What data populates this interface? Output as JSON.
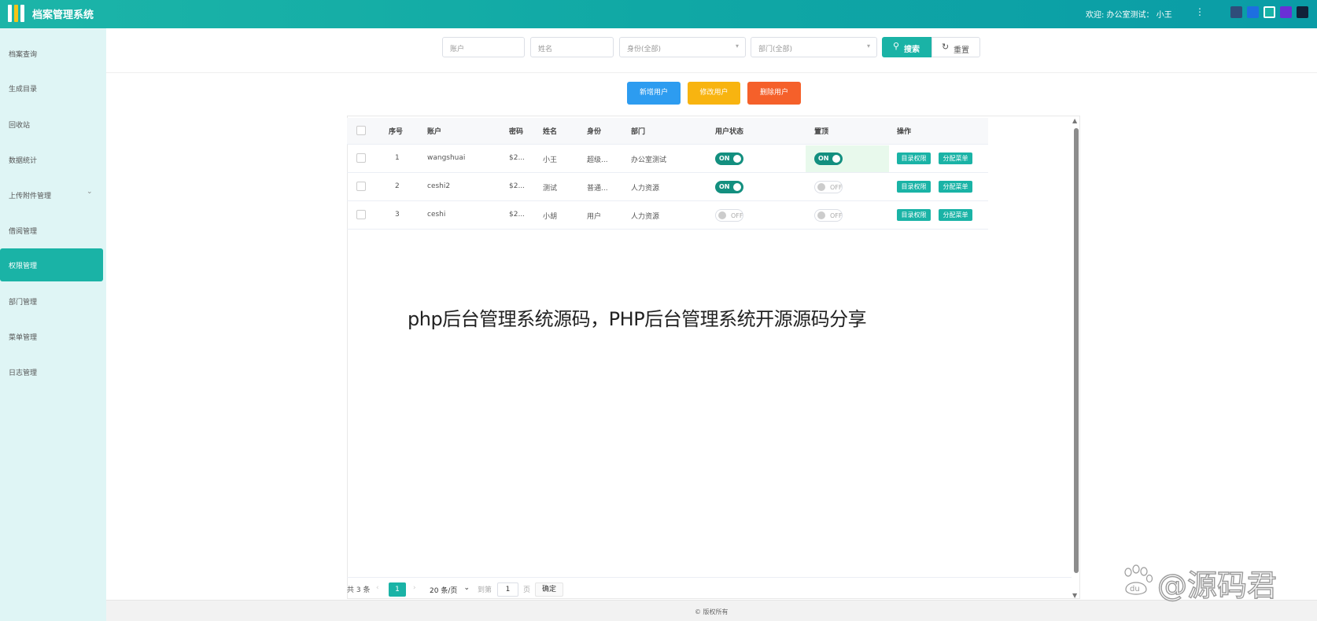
{
  "header": {
    "app_title": "档案管理系统",
    "welcome": "欢迎: 办公室测试： 小王",
    "theme_colors": [
      "#2f4d7a",
      "#1d6fe0",
      "#17b3a6",
      "#6a2fd6",
      "#11223a"
    ]
  },
  "sidebar": {
    "items": [
      {
        "label": "档案查询"
      },
      {
        "label": "生成目录"
      },
      {
        "label": "回收站"
      },
      {
        "label": "数据统计"
      },
      {
        "label": "上传附件管理"
      },
      {
        "label": "借阅管理"
      },
      {
        "label": "权限管理"
      },
      {
        "label": "部门管理"
      },
      {
        "label": "菜单管理"
      },
      {
        "label": "日志管理"
      }
    ],
    "active_index": 6
  },
  "filters": {
    "account_placeholder": "账户",
    "name_placeholder": "姓名",
    "identity_value": "身份(全部)",
    "dept_value": "部门(全部)",
    "search_label": "搜索",
    "reset_label": "重置"
  },
  "actions": {
    "add": "新增用户",
    "edit": "修改用户",
    "delete": "删除用户"
  },
  "table": {
    "headers": {
      "index": "序号",
      "account": "账户",
      "password": "密码",
      "name": "姓名",
      "identity": "身份",
      "dept": "部门",
      "status": "用户状态",
      "top": "置顶",
      "ops": "操作"
    },
    "rows": [
      {
        "index": "1",
        "account": "wangshuai",
        "password": "$2...",
        "name": "小王",
        "identity": "超级...",
        "dept": "办公室测试",
        "status": "ON",
        "top": "ON"
      },
      {
        "index": "2",
        "account": "ceshi2",
        "password": "$2...",
        "name": "测试",
        "identity": "普通...",
        "dept": "人力资源",
        "status": "ON",
        "top": "OFF"
      },
      {
        "index": "3",
        "account": "ceshi",
        "password": "$2...",
        "name": "小胡",
        "identity": "用户",
        "dept": "人力资源",
        "status": "OFF",
        "top": "OFF"
      }
    ],
    "op_buttons": {
      "dir_perm": "目录权限",
      "assign_menu": "分配菜单"
    }
  },
  "pagination": {
    "total": "共 3 条",
    "current_page": "1",
    "page_size": "20 条/页",
    "goto": "到第",
    "goto_value": "1",
    "page_unit": "页",
    "confirm": "确定"
  },
  "footer": {
    "copyright": "© 版权所有"
  },
  "overlay": {
    "caption": "php后台管理系统源码，PHP后台管理系统开源源码分享",
    "watermark_text": "@源码君",
    "watermark_logo_text": "du"
  }
}
